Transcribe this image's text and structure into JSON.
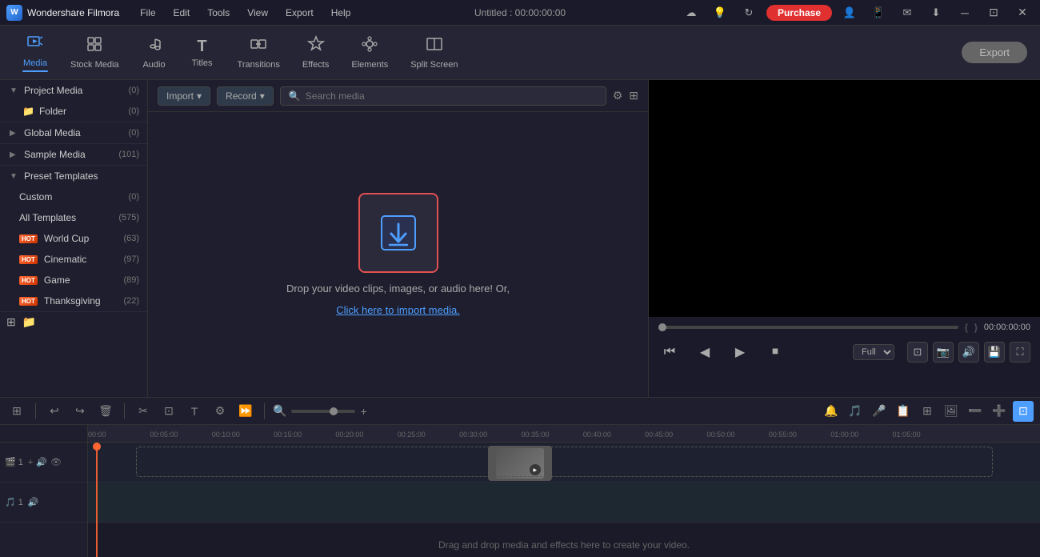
{
  "app": {
    "name": "Wondershare Filmora",
    "title": "Untitled : 00:00:00:00"
  },
  "titlebar": {
    "menus": [
      "File",
      "Edit",
      "Tools",
      "View",
      "Export",
      "Help"
    ],
    "purchase_label": "Purchase",
    "window_controls": [
      "minimize",
      "maximize",
      "close"
    ]
  },
  "toolbar": {
    "items": [
      {
        "id": "media",
        "label": "Media",
        "icon": "🎬",
        "active": true
      },
      {
        "id": "stock-media",
        "label": "Stock Media",
        "icon": "📦"
      },
      {
        "id": "audio",
        "label": "Audio",
        "icon": "🎵"
      },
      {
        "id": "titles",
        "label": "Titles",
        "icon": "T"
      },
      {
        "id": "transitions",
        "label": "Transitions",
        "icon": "⟷"
      },
      {
        "id": "effects",
        "label": "Effects",
        "icon": "✦"
      },
      {
        "id": "elements",
        "label": "Elements",
        "icon": "◈"
      },
      {
        "id": "split-screen",
        "label": "Split Screen",
        "icon": "⊞"
      }
    ],
    "export_label": "Export"
  },
  "left_panel": {
    "project_media": {
      "label": "Project Media",
      "count": "(0)"
    },
    "folder": {
      "label": "Folder",
      "count": "(0)"
    },
    "global_media": {
      "label": "Global Media",
      "count": "(0)"
    },
    "sample_media": {
      "label": "Sample Media",
      "count": "(101)"
    },
    "preset_templates": {
      "label": "Preset Templates",
      "children": [
        {
          "label": "Custom",
          "count": "(0)",
          "hot": false
        },
        {
          "label": "All Templates",
          "count": "(575)",
          "hot": false
        },
        {
          "label": "World Cup",
          "count": "(63)",
          "hot": true
        },
        {
          "label": "Cinematic",
          "count": "(97)",
          "hot": true
        },
        {
          "label": "Game",
          "count": "(89)",
          "hot": true
        },
        {
          "label": "Thanksgiving",
          "count": "(22)",
          "hot": true
        }
      ]
    }
  },
  "center_panel": {
    "import_label": "Import",
    "record_label": "Record",
    "search_placeholder": "Search media",
    "drop_text": "Drop your video clips, images, or audio here! Or,",
    "drop_link": "Click here to import media."
  },
  "preview": {
    "time": "00:00:00:00",
    "quality": "Full",
    "controls": [
      "step-back",
      "play-back",
      "play",
      "stop"
    ]
  },
  "timeline": {
    "ruler_marks": [
      "00:00",
      "00:05:00",
      "00:10:00",
      "00:15:00",
      "00:20:00",
      "00:25:00",
      "00:30:00",
      "00:35:00",
      "00:40:00",
      "00:45:00",
      "00:50:00",
      "00:55:00",
      "01:00:00",
      "01:05:00"
    ],
    "drag_hint": "Drag and drop media and effects here to create your video.",
    "tracks": [
      {
        "type": "video",
        "num": "1",
        "icons": [
          "camera",
          "add",
          "audio",
          "eye"
        ]
      },
      {
        "type": "audio",
        "num": "1",
        "icons": [
          "music",
          "audio"
        ]
      }
    ]
  }
}
